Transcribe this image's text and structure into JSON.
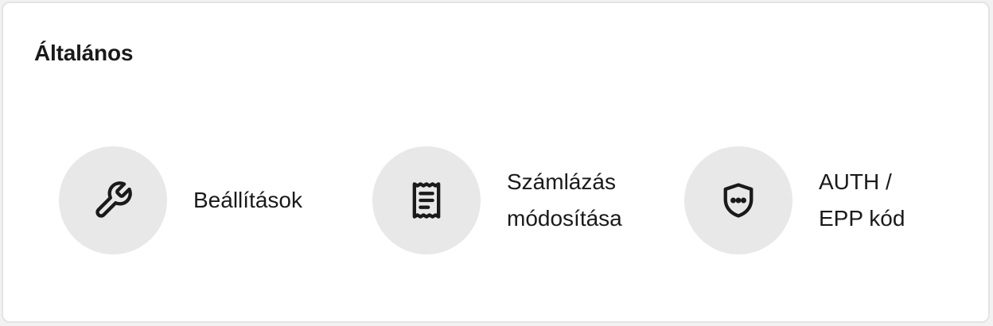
{
  "section": {
    "title": "Általános"
  },
  "actions": [
    {
      "label": "Beállítások",
      "icon": "wrench-icon"
    },
    {
      "label": "Számlázás\nmódosítása",
      "icon": "receipt-icon"
    },
    {
      "label": "AUTH /\nEPP kód",
      "icon": "shield-icon"
    }
  ],
  "colors": {
    "card_background": "#ffffff",
    "card_border": "#e4e4e4",
    "icon_circle": "#e8e8e8",
    "text": "#1a1a1a"
  }
}
